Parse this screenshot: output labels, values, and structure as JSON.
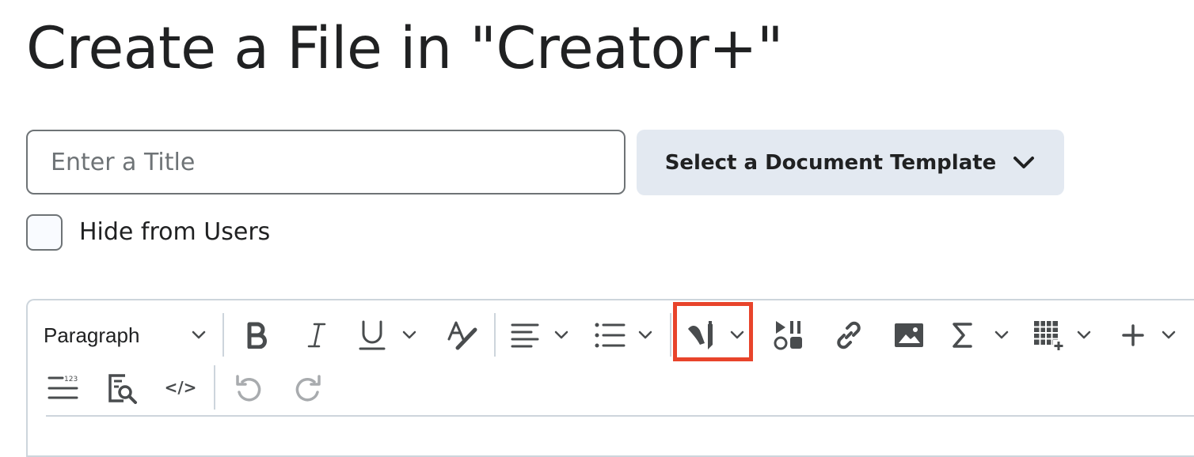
{
  "page": {
    "title": "Create a File in \"Creator+\""
  },
  "form": {
    "title_placeholder": "Enter a Title",
    "template_button_label": "Select a Document Template",
    "hide_checkbox_label": "Hide from Users",
    "hide_checked": false
  },
  "toolbar": {
    "block_format_value": "Paragraph",
    "row1": [
      {
        "name": "block-format-dropdown",
        "icon": "chevron-down-icon"
      },
      {
        "name": "bold-button",
        "icon": "bold-icon"
      },
      {
        "name": "italic-button",
        "icon": "italic-icon"
      },
      {
        "name": "underline-button",
        "icon": "underline-icon"
      },
      {
        "name": "font-format-button",
        "icon": "text-format-icon"
      },
      {
        "name": "align-button",
        "icon": "align-left-icon"
      },
      {
        "name": "list-button",
        "icon": "bullet-list-icon"
      },
      {
        "name": "insert-stuff-button",
        "icon": "pen-icon"
      },
      {
        "name": "media-button",
        "icon": "media-icon"
      },
      {
        "name": "link-button",
        "icon": "link-icon"
      },
      {
        "name": "image-button",
        "icon": "image-icon"
      },
      {
        "name": "equation-button",
        "icon": "sigma-icon"
      },
      {
        "name": "table-button",
        "icon": "table-icon"
      },
      {
        "name": "more-button",
        "icon": "plus-icon"
      }
    ],
    "row2": [
      {
        "name": "word-count-button",
        "icon": "word-count-icon"
      },
      {
        "name": "find-replace-button",
        "icon": "find-icon"
      },
      {
        "name": "source-code-button",
        "icon": "code-icon"
      },
      {
        "name": "undo-button",
        "icon": "undo-icon"
      },
      {
        "name": "redo-button",
        "icon": "redo-icon"
      }
    ],
    "word_count_glyph": "123",
    "code_glyph": "</>",
    "highlight_color": "#e8442b"
  },
  "colors": {
    "text": "#202122",
    "icon": "#494c4e",
    "disabled_icon": "#a8abae",
    "template_button_bg": "#e3e9f1",
    "border": "#cdd5dc"
  }
}
